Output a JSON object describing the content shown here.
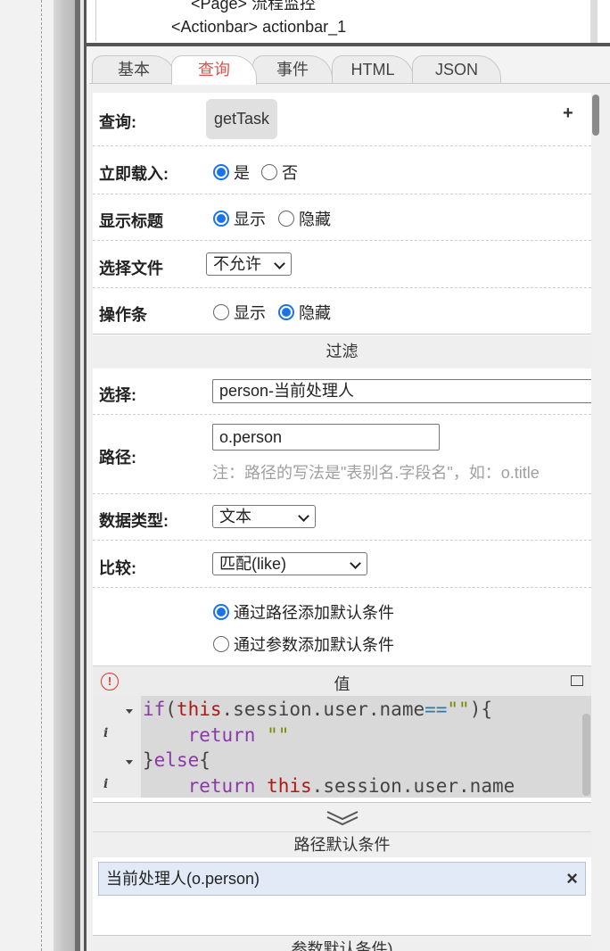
{
  "tree": {
    "node_page": "<Page> 流程监控",
    "node_actionbar": "<Actionbar> actionbar_1"
  },
  "tabs": [
    {
      "label": "基本"
    },
    {
      "label": "查询",
      "active": true
    },
    {
      "label": "事件"
    },
    {
      "label": "HTML"
    },
    {
      "label": "JSON"
    }
  ],
  "form": {
    "query": {
      "label": "查询:",
      "value": "getTask",
      "add_symbol": "+"
    },
    "load_now": {
      "label": "立即载入:",
      "options": [
        "是",
        "否"
      ],
      "selected": "是"
    },
    "show_title": {
      "label": "显示标题",
      "options": [
        "显示",
        "隐藏"
      ],
      "selected": "显示"
    },
    "select_file": {
      "label": "选择文件",
      "value": "不允许"
    },
    "action_bar": {
      "label": "操作条",
      "options": [
        "显示",
        "隐藏"
      ],
      "selected": "隐藏"
    }
  },
  "filter": {
    "title": "过滤",
    "select": {
      "label": "选择:",
      "value": "person-当前处理人"
    },
    "path": {
      "label": "路径:",
      "value": "o.person",
      "note": "注：路径的写法是\"表别名.字段名\"，如：o.title"
    },
    "data_type": {
      "label": "数据类型:",
      "value": "文本"
    },
    "compare": {
      "label": "比较:",
      "value": "匹配(like)"
    },
    "add_mode": {
      "options": [
        "通过路径添加默认条件",
        "通过参数添加默认条件"
      ],
      "selected": "通过路径添加默认条件"
    }
  },
  "value_editor": {
    "title": "值",
    "colors": {
      "keyword": "#8a3aa8",
      "this": "#b01818",
      "string": "#7a8a00",
      "operator": "#2a7ab0"
    }
  },
  "path_conditions": {
    "title": "路径默认条件",
    "items": [
      {
        "label": "当前处理人(o.person)"
      }
    ],
    "remove_symbol": "×"
  },
  "param_conditions": {
    "title": "参数默认条件)"
  },
  "colors": {
    "active_tab": "#d9534f",
    "radio_accent": "#1a73e8",
    "tag_bg": "#e2eaf8"
  }
}
